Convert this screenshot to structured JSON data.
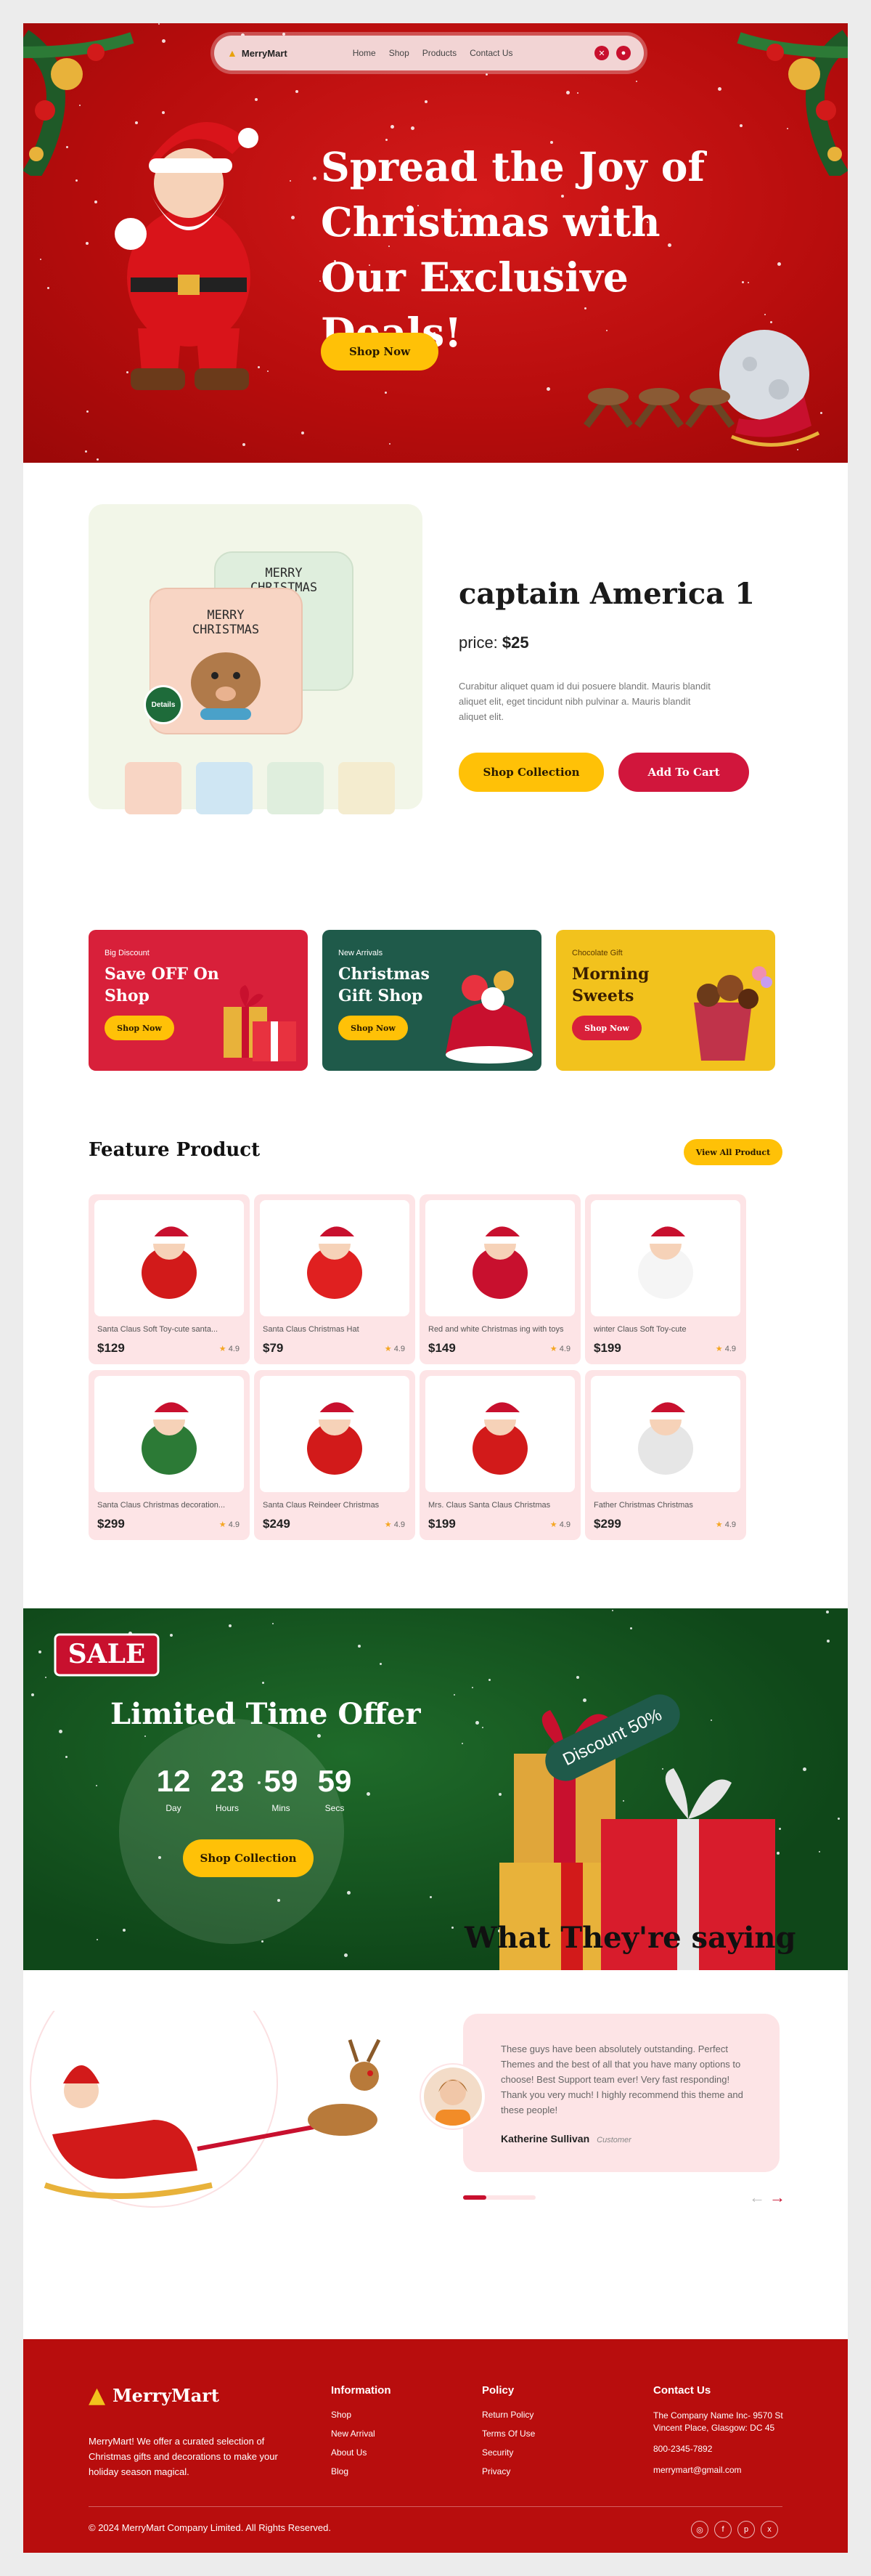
{
  "nav": {
    "brand": "MerryMart",
    "links": [
      "Home",
      "Shop",
      "Products",
      "Contact Us"
    ]
  },
  "hero": {
    "title": "Spread the Joy of Christmas with Our Exclusive Deals!",
    "button": "Shop Now"
  },
  "product_detail": {
    "details_badge": "Details",
    "title": "captain America 1",
    "price_label": "price:",
    "price": "$25",
    "description": "Curabitur aliquet quam id dui posuere blandit. Mauris blandit aliquet elit, eget tincidunt nibh pulvinar a. Mauris blandit aliquet elit.",
    "shop_button": "Shop Collection",
    "cart_button": "Add To Cart"
  },
  "promos": [
    {
      "small": "Big Discount",
      "title": "Save OFF On Shop",
      "button": "Shop Now",
      "bg": "#d8203a"
    },
    {
      "small": "New Arrivals",
      "title": "Christmas Gift Shop",
      "button": "Shop Now",
      "bg": "#1f5a4a"
    },
    {
      "small": "Chocolate Gift",
      "title": "Morning Sweets",
      "button": "Shop Now",
      "bg": "#f2c21d"
    }
  ],
  "feature": {
    "title": "Feature Product",
    "view_all": "View All Product",
    "products": [
      {
        "name": "Santa Claus Soft Toy-cute santa...",
        "price": "$129",
        "rating": "4.9"
      },
      {
        "name": "Santa Claus Christmas Hat",
        "price": "$79",
        "rating": "4.9"
      },
      {
        "name": "Red and white Christmas ing with toys",
        "price": "$149",
        "rating": "4.9"
      },
      {
        "name": "winter Claus Soft Toy-cute",
        "price": "$199",
        "rating": "4.9"
      },
      {
        "name": "Santa Claus Christmas decoration...",
        "price": "$299",
        "rating": "4.9"
      },
      {
        "name": "Santa Claus Reindeer Christmas",
        "price": "$249",
        "rating": "4.9"
      },
      {
        "name": "Mrs. Claus Santa Claus Christmas",
        "price": "$199",
        "rating": "4.9"
      },
      {
        "name": "Father Christmas Christmas",
        "price": "$299",
        "rating": "4.9"
      }
    ]
  },
  "offer": {
    "sale": "SALE",
    "title": "Limited Time Offer",
    "countdown": [
      {
        "value": "12",
        "label": "Day"
      },
      {
        "value": "23",
        "label": "Hours"
      },
      {
        "value": "59",
        "label": "Mins"
      },
      {
        "value": "59",
        "label": "Secs"
      }
    ],
    "button": "Shop Collection",
    "discount": "Discount 50%"
  },
  "testimonial": {
    "title": "What They're saying",
    "text": "These guys have been absolutely outstanding. Perfect Themes and the best of all that you have many options to choose! Best Support team ever! Very fast responding! Thank you very much! I highly recommend this theme and these people!",
    "name": "Katherine Sullivan",
    "role": "Customer"
  },
  "footer": {
    "brand": "MerryMart",
    "about": "MerryMart! We offer a curated selection of Christmas gifts and decorations to make your holiday season magical.",
    "information": {
      "heading": "Information",
      "links": [
        "Shop",
        "New Arrival",
        "About Us",
        "Blog"
      ]
    },
    "policy": {
      "heading": "Policy",
      "links": [
        "Return Policy",
        "Terms Of Use",
        "Security",
        "Privacy"
      ]
    },
    "contact": {
      "heading": "Contact Us",
      "address": "The Company Name Inc- 9570 St Vincent Place, Glasgow: DC 45",
      "phone": "800-2345-7892",
      "email": "merrymart@gmail.com"
    },
    "copyright": "© 2024 MerryMart Company Limited. All Rights Reserved."
  },
  "colors": {
    "brand_red": "#c8102e",
    "accent_yellow": "#ffc107",
    "offer_green": "#0f4719"
  }
}
